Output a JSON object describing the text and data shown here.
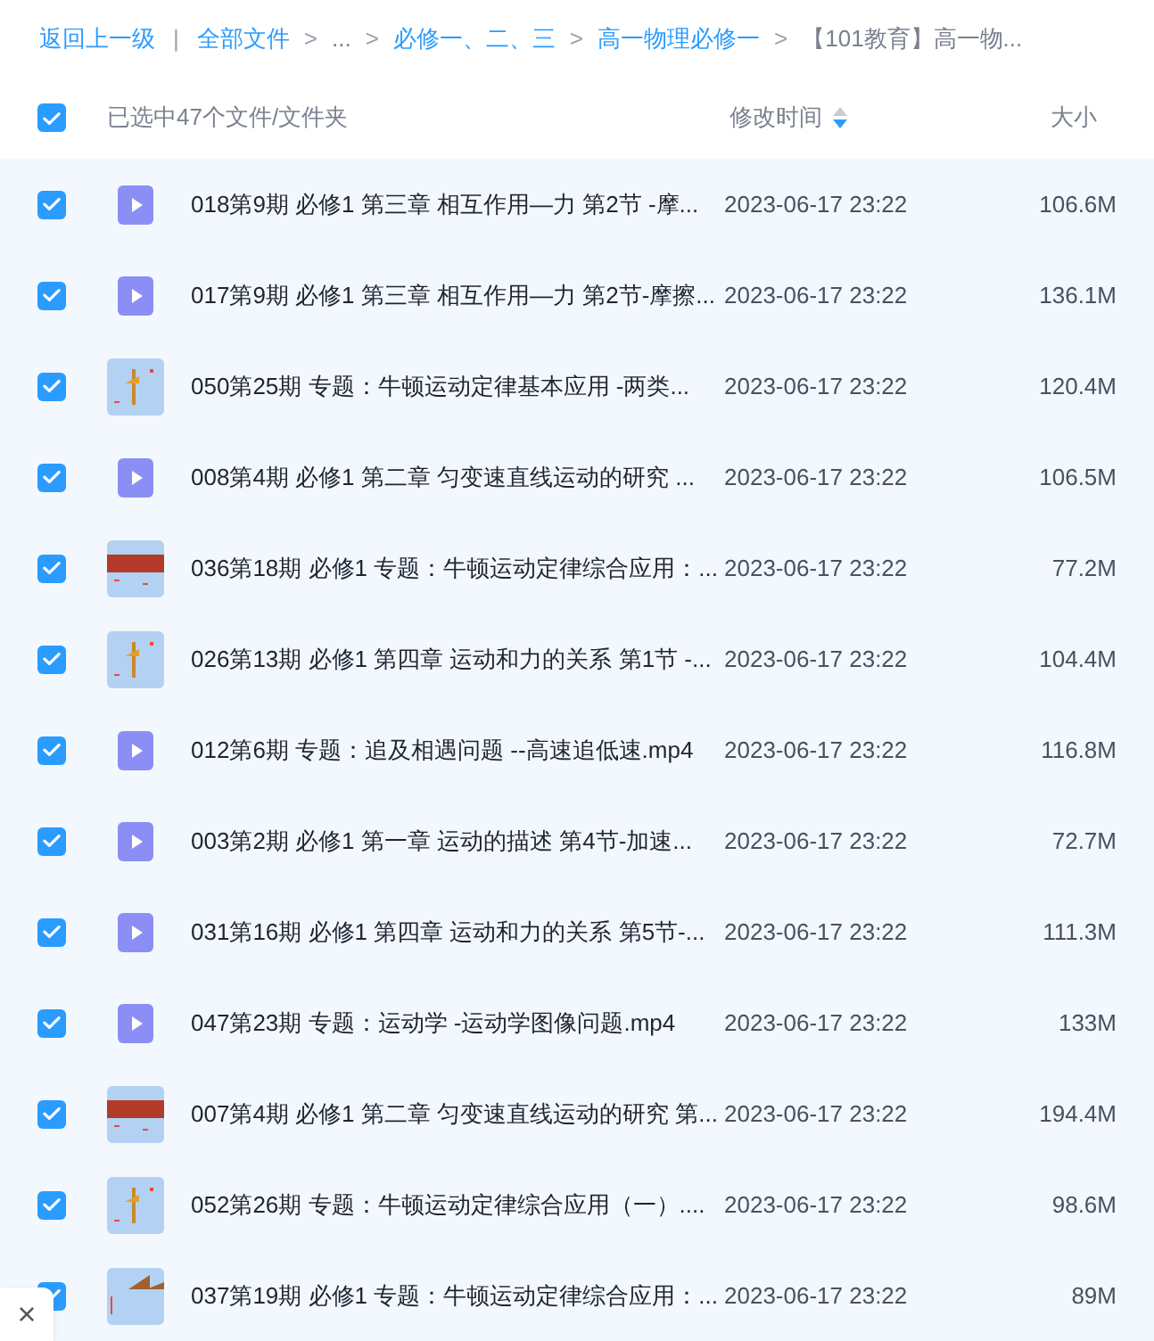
{
  "back_link": "返回上一级",
  "breadcrumb": [
    {
      "separator": "|",
      "label": "全部文件",
      "link": true
    },
    {
      "separator": ">",
      "label": "...",
      "link": false
    },
    {
      "separator": ">",
      "label": "必修一、二、三",
      "link": true
    },
    {
      "separator": ">",
      "label": "高一物理必修一",
      "link": true
    },
    {
      "separator": ">",
      "label": "【101教育】高一物...",
      "link": false
    }
  ],
  "header": {
    "all_checked": true,
    "selection": "已选中47个文件/文件夹",
    "modified": "修改时间",
    "size": "大小"
  },
  "rows": [
    {
      "kind": "video",
      "checked": true,
      "name": "018第9期 必修1 第三章 相互作用—力 第2节 -摩...",
      "time": "2023-06-17 23:22",
      "size": "106.6M"
    },
    {
      "kind": "video",
      "checked": true,
      "name": "017第9期 必修1 第三章 相互作用—力 第2节-摩擦...",
      "time": "2023-06-17 23:22",
      "size": "136.1M"
    },
    {
      "kind": "picture",
      "checked": true,
      "name": "050第25期 专题：牛顿运动定律基本应用 -两类...",
      "time": "2023-06-17 23:22",
      "size": "120.4M"
    },
    {
      "kind": "video",
      "checked": true,
      "name": "008第4期 必修1 第二章 匀变速直线运动的研究 ...",
      "time": "2023-06-17 23:22",
      "size": "106.5M"
    },
    {
      "kind": "picture",
      "checked": true,
      "name": "036第18期 必修1 专题：牛顿运动定律综合应用：...",
      "time": "2023-06-17 23:22",
      "size": "77.2M"
    },
    {
      "kind": "picture",
      "checked": true,
      "name": "026第13期 必修1 第四章 运动和力的关系 第1节 -...",
      "time": "2023-06-17 23:22",
      "size": "104.4M"
    },
    {
      "kind": "video",
      "checked": true,
      "name": "012第6期 专题：追及相遇问题 --高速追低速.mp4",
      "time": "2023-06-17 23:22",
      "size": "116.8M"
    },
    {
      "kind": "video",
      "checked": true,
      "name": "003第2期 必修1 第一章 运动的描述 第4节-加速...",
      "time": "2023-06-17 23:22",
      "size": "72.7M"
    },
    {
      "kind": "video",
      "checked": true,
      "name": "031第16期 必修1 第四章 运动和力的关系 第5节-...",
      "time": "2023-06-17 23:22",
      "size": "111.3M"
    },
    {
      "kind": "video",
      "checked": true,
      "name": "047第23期 专题：运动学 -运动学图像问题.mp4",
      "time": "2023-06-17 23:22",
      "size": "133M"
    },
    {
      "kind": "picture",
      "checked": true,
      "name": "007第4期 必修1 第二章 匀变速直线运动的研究 第...",
      "time": "2023-06-17 23:22",
      "size": "194.4M"
    },
    {
      "kind": "picture",
      "checked": true,
      "name": "052第26期 专题：牛顿运动定律综合应用（一）....",
      "time": "2023-06-17 23:22",
      "size": "98.6M"
    },
    {
      "kind": "picture",
      "checked": true,
      "name": "037第19期 必修1 专题：牛顿运动定律综合应用：...",
      "time": "2023-06-17 23:22",
      "size": "89M"
    }
  ],
  "close_popup": {
    "label": "×"
  }
}
